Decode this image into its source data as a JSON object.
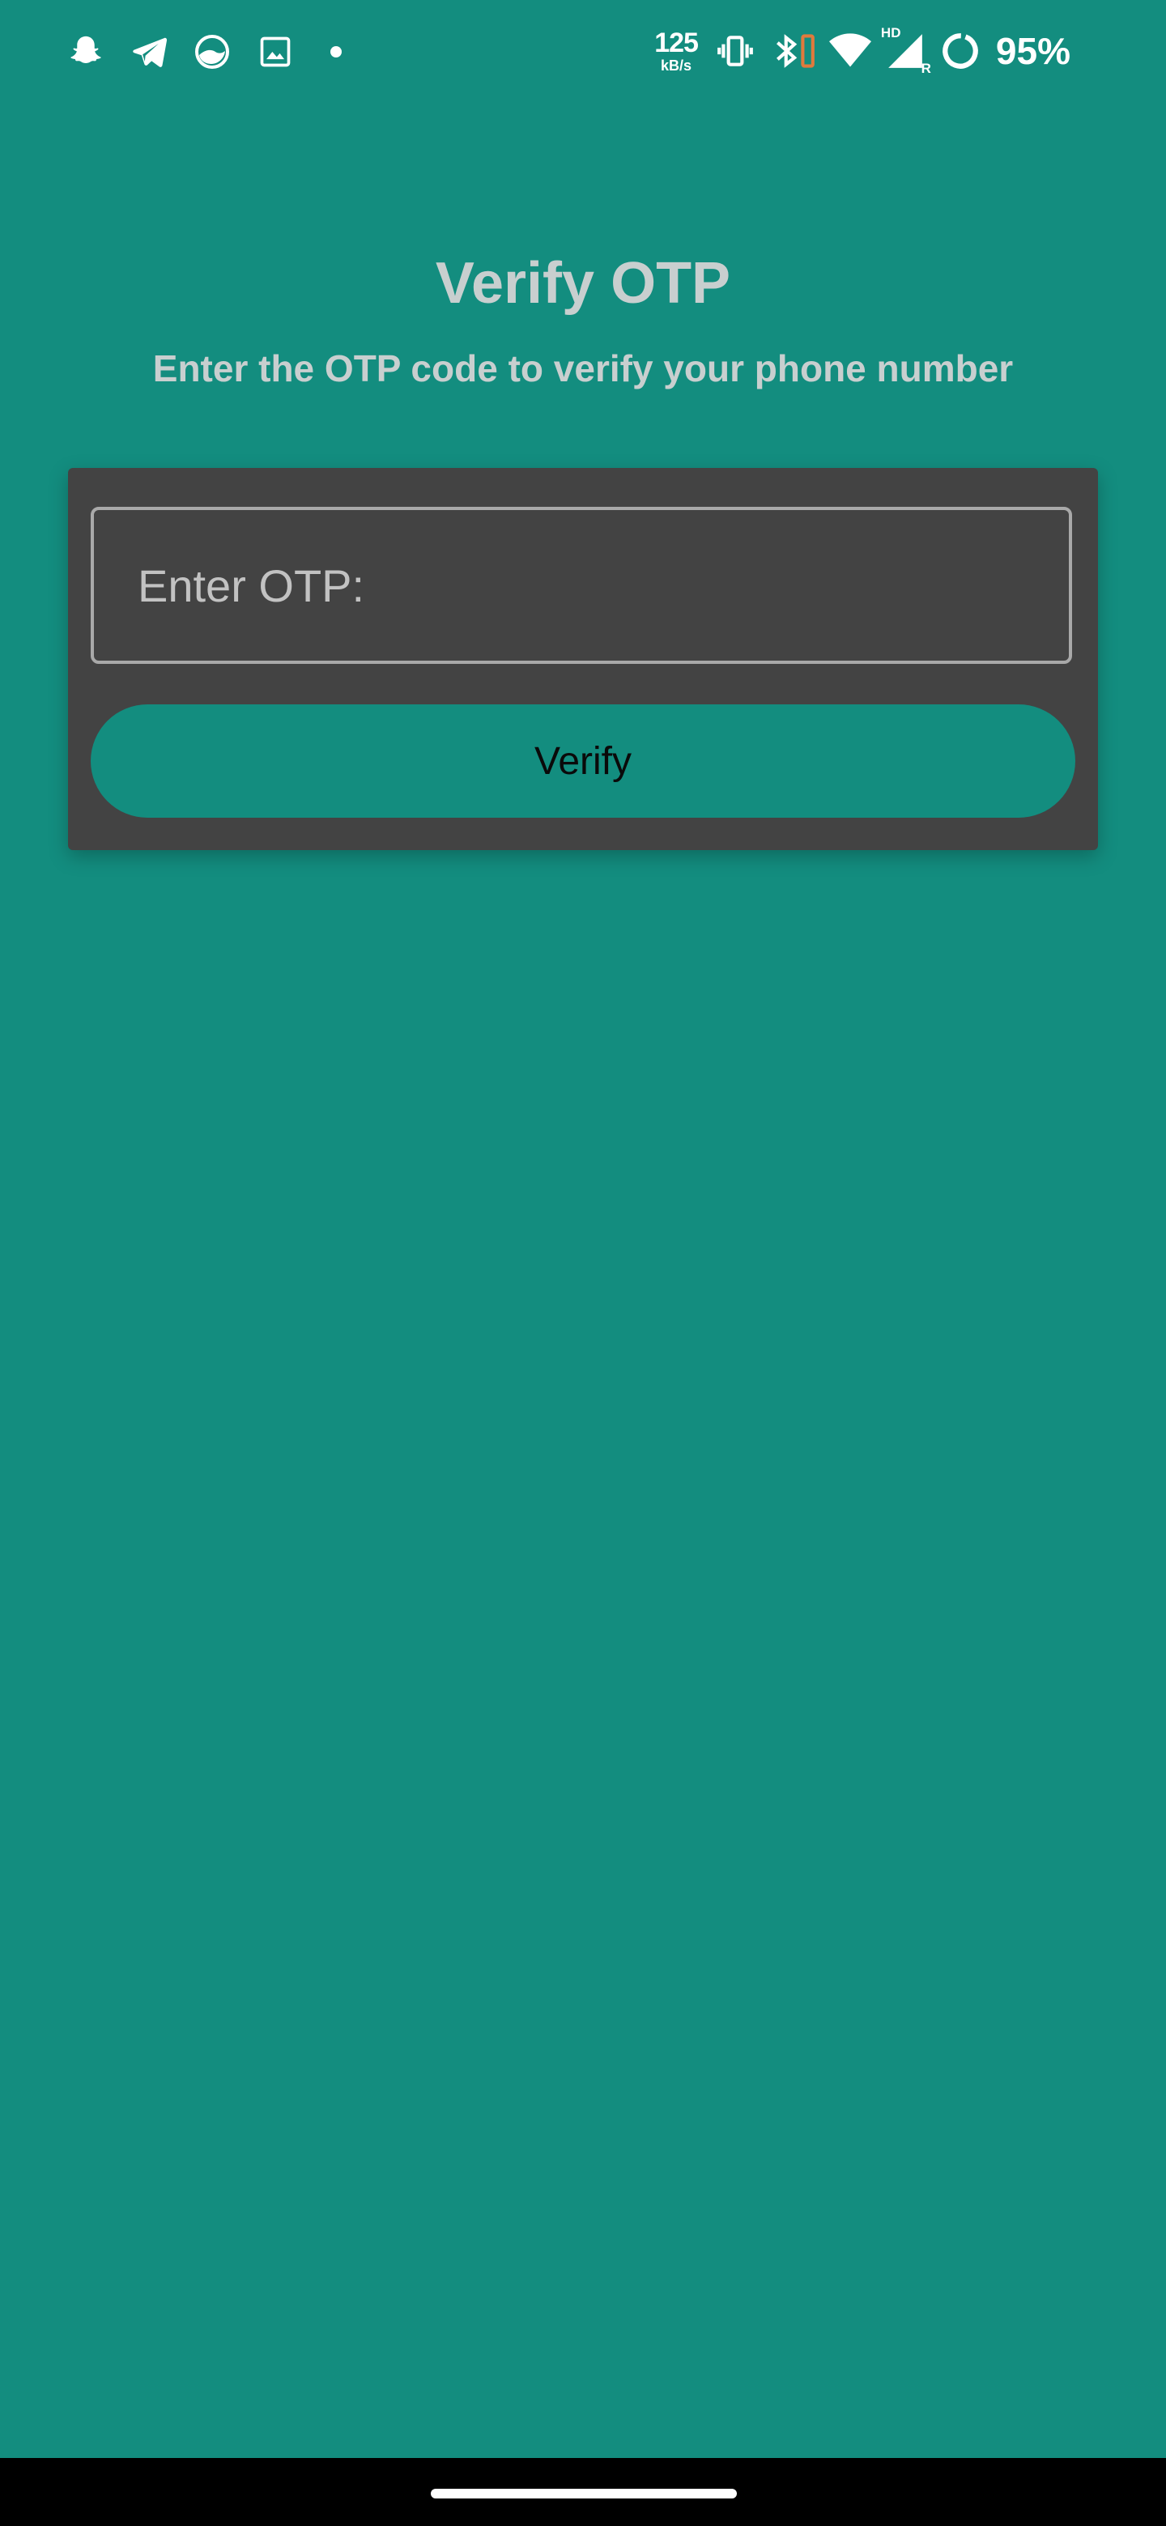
{
  "status_bar": {
    "left_icons": [
      "snapchat-icon",
      "telegram-icon",
      "app-icon",
      "gallery-icon"
    ],
    "network_speed": "125",
    "network_speed_unit": "kB/s",
    "signal_label": "HD",
    "roaming_label": "R",
    "battery_percent": "95%"
  },
  "page": {
    "title": "Verify OTP",
    "subtitle": "Enter the OTP code to verify your phone number"
  },
  "form": {
    "otp_placeholder": "Enter OTP:",
    "otp_value": "",
    "verify_label": "Verify"
  },
  "colors": {
    "background": "#138d7f",
    "card": "#434343",
    "button": "#138d7f",
    "text_muted": "#c8cfcf"
  }
}
